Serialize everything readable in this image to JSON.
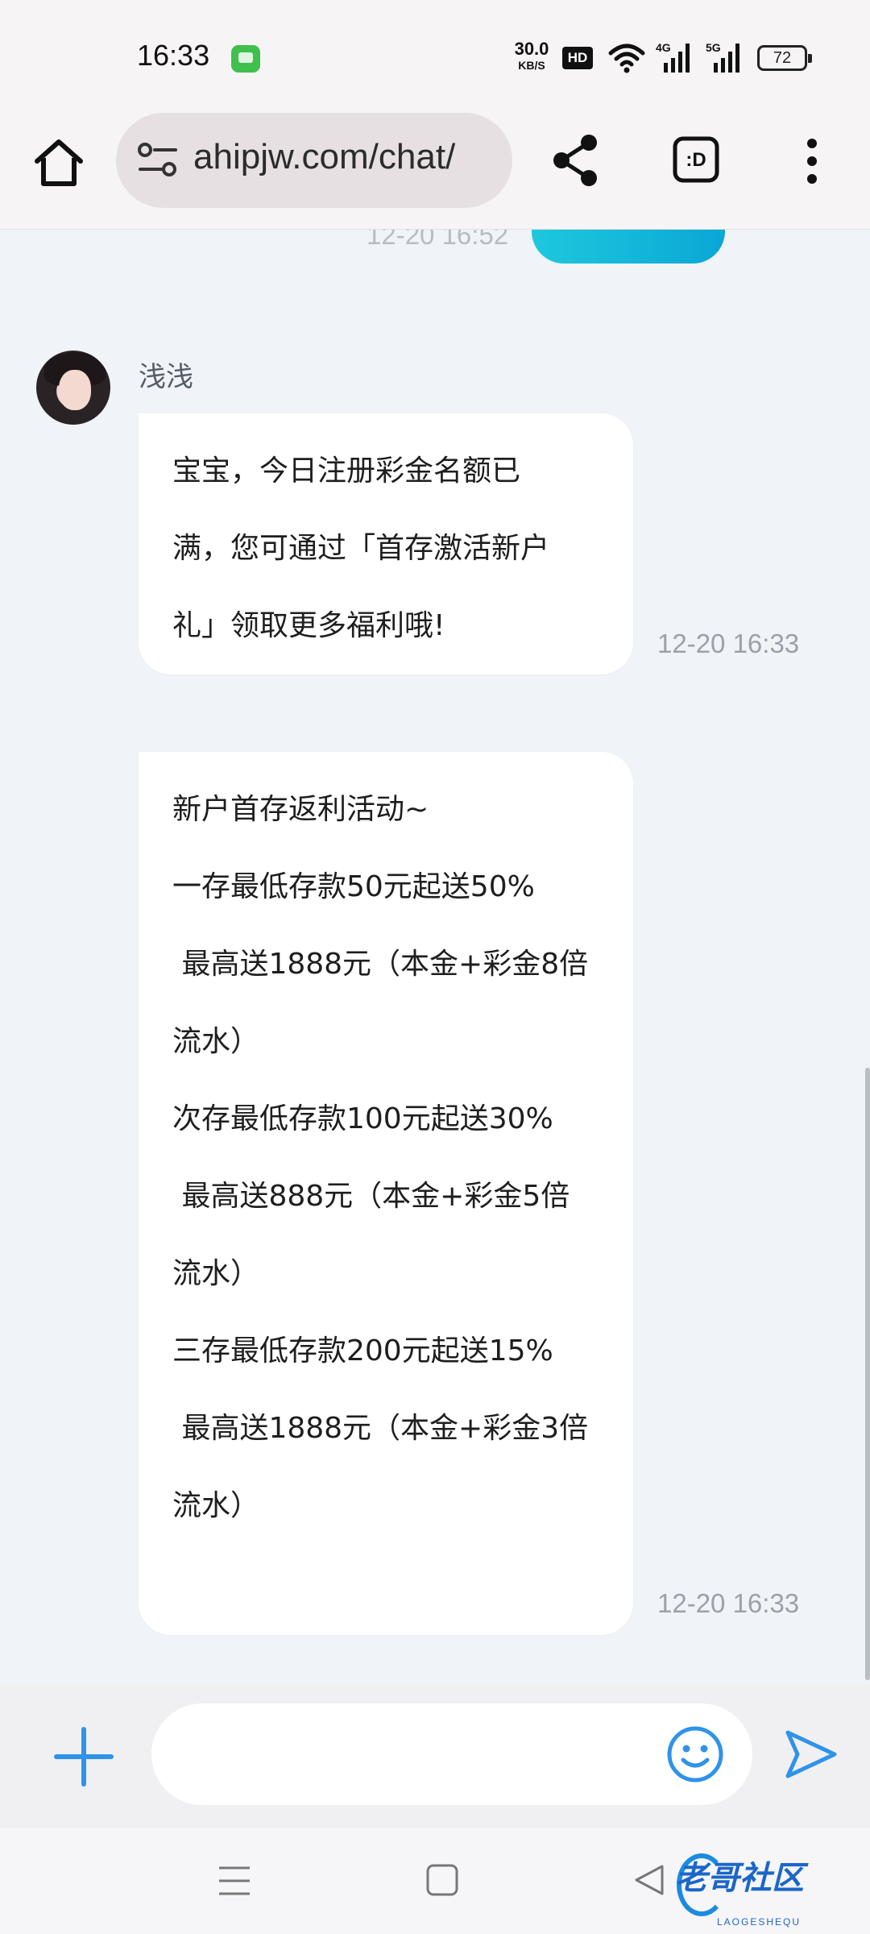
{
  "status_bar": {
    "time": "16:33",
    "net_speed_value": "30.0",
    "net_speed_unit": "KB/S",
    "hd_label": "HD",
    "battery": "72"
  },
  "browser": {
    "url": "ahipjw.com/chat/"
  },
  "chat": {
    "previous_time": "12-20 16:52",
    "sender_name": "浅浅",
    "messages": [
      {
        "lines": [
          "宝宝，今日注册彩金名额已",
          "满，您可通过「首存激活新户",
          "礼」领取更多福利哦!"
        ],
        "time": "12-20 16:33"
      },
      {
        "lines": [
          "新户首存返利活动~",
          "一存最低存款50元起送50%",
          " 最高送1888元（本金+彩金8倍",
          "流水）",
          "次存最低存款100元起送30%",
          " 最高送888元（本金+彩金5倍",
          "流水）",
          "三存最低存款200元起送15%",
          " 最高送1888元（本金+彩金3倍",
          "流水）"
        ],
        "time": "12-20 16:33"
      }
    ]
  },
  "input": {
    "placeholder": ""
  },
  "watermark": {
    "text": "老哥社区",
    "sub": "LAOGESHEQU"
  },
  "colors": {
    "accent": "#2f93e8",
    "outgoing_bubble": "#12b8d8",
    "bubble": "#ffffff",
    "chat_bg": "#f0f3f8"
  },
  "icons": [
    "home-icon",
    "site-settings-icon",
    "share-icon",
    "tab-switcher-icon",
    "more-icon",
    "plus-icon",
    "emoji-icon",
    "send-icon",
    "menu-icon",
    "home-square-icon",
    "back-icon"
  ]
}
